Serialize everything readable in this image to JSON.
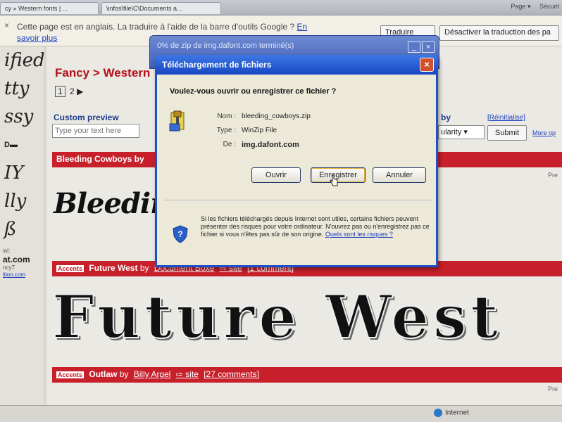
{
  "browser": {
    "tabs": [
      "cy » Western fonts | ...",
      "\\infos\\file\\C\\Documents a..."
    ],
    "toolbar": [
      "Page ▾",
      "Sécurit"
    ]
  },
  "translate_bar": {
    "message": "Cette page est en anglais. La traduire à l'aide de la barre d'outils Google ?",
    "link_en": "En",
    "link_savoir": "savoir plus",
    "translate_button": "Traduire",
    "disable_button": "Désactiver la traduction des pa"
  },
  "left_column": {
    "samples": [
      "ified",
      "tty",
      "ssy",
      "D▬",
      "IY",
      "lly",
      "ß"
    ],
    "label": "at.com",
    "footer1": "ial:",
    "footer2": "ncyT",
    "footer3": "ition.com"
  },
  "page": {
    "breadcrumb": "Fancy > Western",
    "pager_current": "1",
    "pager_next": "2",
    "pager_arrow": "▶",
    "custom_preview_label": "Custom preview",
    "custom_preview_placeholder": "Type your text here",
    "sort_label": "by",
    "reinit_link": "[Réinitialise]",
    "sort_value": "ularity",
    "submit_button": "Submit",
    "more_options": "More op",
    "font1_header": "Bleeding Cowboys by",
    "font1_sample": "Bleeding",
    "font2_tag": "Accents",
    "font2_name": "Future West",
    "font2_by": "by",
    "font2_author": "Document Boxe",
    "font2_site": "site",
    "font2_comments": "[1 comment]",
    "font2_sample": "Future West",
    "font3_tag": "Accents",
    "font3_name": "Outlaw",
    "font3_by": "by",
    "font3_author": "Billy Argel",
    "font3_site": "site",
    "font3_comments": "[27 comments]",
    "preview_tag": "Pre"
  },
  "back_dialog": {
    "title": "0% de zip de img.dafont.com terminé(s)"
  },
  "download_dialog": {
    "title": "Téléchargement de fichiers",
    "question": "Voulez-vous ouvrir ou enregistrer ce fichier ?",
    "name_label": "Nom :",
    "name_value": "bleeding_cowboys.zip",
    "type_label": "Type :",
    "type_value": "WinZip File",
    "from_label": "De :",
    "from_value": "img.dafont.com",
    "open_button": "Ouvrir",
    "save_button": "Enregistrer",
    "cancel_button": "Annuler",
    "warning": "Si les fichiers téléchargés depuis Internet sont utiles, certains fichiers peuvent présenter des risques pour votre ordinateur. N'ouvrez pas ou n'enregistrez pas ce fichier si vous n'êtes pas sûr de son origine.",
    "warning_link": "Quels sont les risques ?"
  },
  "status_bar": {
    "zone": "Internet"
  }
}
